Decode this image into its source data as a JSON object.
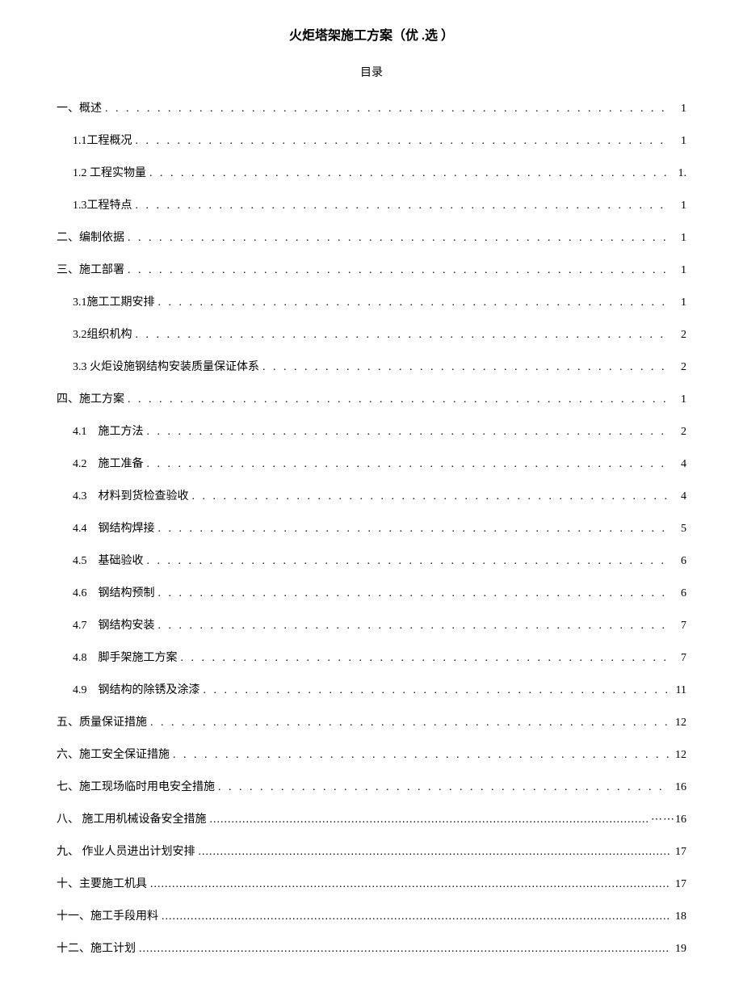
{
  "title": "火炬塔架施工方案（优 .选 ）",
  "toc_heading": "目录",
  "entries": [
    {
      "level": 1,
      "label": "一、概述",
      "page": "1",
      "alt": false
    },
    {
      "level": 2,
      "label": "1.1工程概况",
      "page": "1",
      "alt": false
    },
    {
      "level": 2,
      "label": "1.2 工程实物量",
      "page": "1.",
      "alt": false
    },
    {
      "level": 2,
      "label": "1.3工程特点",
      "page": "1",
      "alt": false
    },
    {
      "level": 1,
      "label": "二、编制依据",
      "page": "1",
      "alt": false
    },
    {
      "level": 1,
      "label": "三、施工部署",
      "page": "1",
      "alt": false
    },
    {
      "level": 2,
      "label": "3.1施工工期安排",
      "page": "1",
      "alt": false
    },
    {
      "level": 2,
      "label": "3.2组织机构",
      "page": "2",
      "alt": false
    },
    {
      "level": 2,
      "label": "3.3 火炬设施钢结构安装质量保证体系",
      "page": "2",
      "alt": false
    },
    {
      "level": 1,
      "label": "四、施工方案",
      "page": "1",
      "alt": false
    },
    {
      "level": 2,
      "label": "4.1",
      "label2": "施工方法",
      "page": "2",
      "alt": false,
      "wide": true
    },
    {
      "level": 2,
      "label": "4.2",
      "label2": "施工准备",
      "page": "4",
      "alt": false,
      "wide": true
    },
    {
      "level": 2,
      "label": "4.3",
      "label2": "材料到货检查验收",
      "page": "4",
      "alt": false,
      "wide": true
    },
    {
      "level": 2,
      "label": "4.4",
      "label2": "钢结构焊接",
      "page": "5",
      "alt": false,
      "wide": true
    },
    {
      "level": 2,
      "label": "4.5",
      "label2": "基础验收",
      "page": "6",
      "alt": false,
      "wide": true
    },
    {
      "level": 2,
      "label": "4.6",
      "label2": "钢结构预制",
      "page": "6",
      "alt": false,
      "wide": true
    },
    {
      "level": 2,
      "label": "4.7",
      "label2": "钢结构安装",
      "page": "7",
      "alt": false,
      "wide": true
    },
    {
      "level": 2,
      "label": "4.8",
      "label2": "脚手架施工方案",
      "page": "7",
      "alt": false,
      "wide": true
    },
    {
      "level": 2,
      "label": "4.9",
      "label2": "钢结构的除锈及涂漆",
      "page": "11",
      "alt": false,
      "wide": true
    },
    {
      "level": 1,
      "label": "五、质量保证措施",
      "page": "12",
      "alt": false
    },
    {
      "level": 1,
      "label": "六、施工安全保证措施",
      "page": "12",
      "alt": false
    },
    {
      "level": 1,
      "label": "七、施工现场临时用电安全措施",
      "page": "16",
      "alt": false
    },
    {
      "level": 1,
      "label": "八、 施工用机械设备安全措施",
      "page": "16",
      "alt": true,
      "prefix": "⋯⋯"
    },
    {
      "level": 1,
      "label": "九、 作业人员进出计划安排",
      "page": "17",
      "alt": true
    },
    {
      "level": 1,
      "label": "十、主要施工机具",
      "page": "17",
      "alt": true
    },
    {
      "level": 1,
      "label": "十一、施工手段用料",
      "page": "18",
      "alt": true
    },
    {
      "level": 1,
      "label": "十二、施工计划",
      "page": "19",
      "alt": true
    }
  ]
}
